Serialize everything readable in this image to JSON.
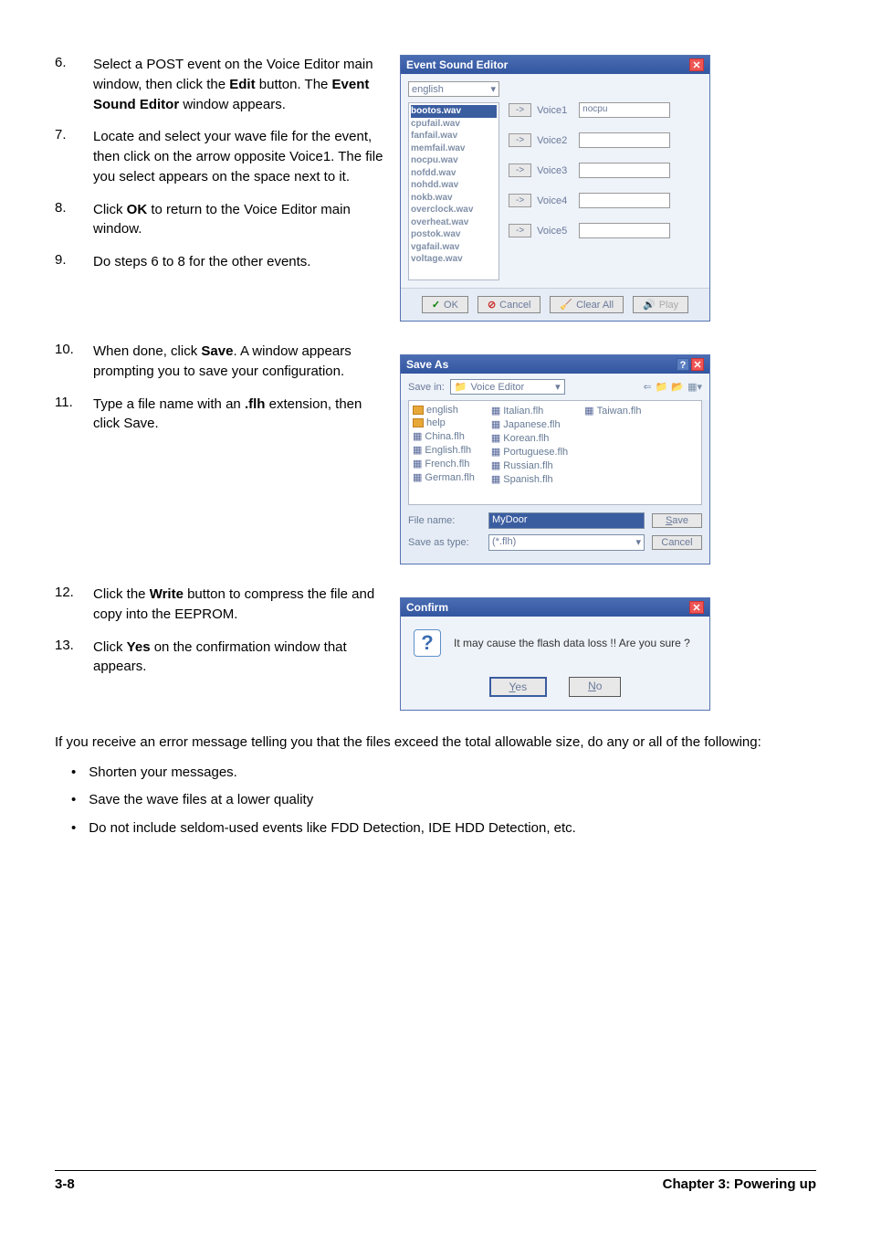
{
  "steps": {
    "s6": {
      "num": "6.",
      "text_a": "Select a POST event on the Voice Editor main window, then click the ",
      "bold1": "Edit",
      "text_b": " button. The ",
      "bold2": "Event Sound Editor",
      "text_c": " window appears."
    },
    "s7": {
      "num": "7.",
      "text": "Locate and select your wave file for the event, then click on the arrow opposite Voice1. The file you select appears on the space next to it."
    },
    "s8": {
      "num": "8.",
      "text_a": "Click ",
      "bold1": "OK",
      "text_b": " to return to the Voice Editor main window."
    },
    "s9": {
      "num": "9.",
      "text": "Do steps 6 to 8 for the other events."
    },
    "s10": {
      "num": "10.",
      "text_a": "When done, click ",
      "bold1": "Save",
      "text_b": ". A window appears prompting you to save your configuration."
    },
    "s11": {
      "num": "11.",
      "text_a": "Type a file name with an ",
      "bold1": ".flh",
      "text_b": " extension, then click Save."
    },
    "s12": {
      "num": "12.",
      "text_a": "Click the ",
      "bold1": "Write",
      "text_b": " button to compress the file and copy into the EEPROM."
    },
    "s13": {
      "num": "13.",
      "text_a": "Click ",
      "bold1": "Yes",
      "text_b": " on the confirmation window that appears."
    }
  },
  "paragraph": "If you receive an error message telling you that the files exceed the total allowable size, do any or all of the following:",
  "bullets": [
    "Shorten your messages.",
    "Save the wave files at a lower quality",
    "Do not include seldom-used events like FDD Detection, IDE HDD Detection, etc."
  ],
  "ese": {
    "title": "Event Sound Editor",
    "dropdown": "english",
    "files": [
      "bootos.wav",
      "cpufail.wav",
      "fanfail.wav",
      "memfail.wav",
      "nocpu.wav",
      "nofdd.wav",
      "nohdd.wav",
      "nokb.wav",
      "overclock.wav",
      "overheat.wav",
      "postok.wav",
      "vgafail.wav",
      "voltage.wav"
    ],
    "voices": [
      {
        "label": "Voice1",
        "value": "nocpu"
      },
      {
        "label": "Voice2",
        "value": ""
      },
      {
        "label": "Voice3",
        "value": ""
      },
      {
        "label": "Voice4",
        "value": ""
      },
      {
        "label": "Voice5",
        "value": ""
      }
    ],
    "buttons": {
      "ok": "OK",
      "cancel": "Cancel",
      "clearall": "Clear All",
      "play": "Play"
    }
  },
  "saveas": {
    "title": "Save As",
    "save_in_label": "Save in:",
    "folder": "Voice Editor",
    "col1": [
      "english",
      "help",
      "China.flh",
      "English.flh",
      "French.flh",
      "German.flh"
    ],
    "col2": [
      "Italian.flh",
      "Japanese.flh",
      "Korean.flh",
      "Portuguese.flh",
      "Russian.flh",
      "Spanish.flh"
    ],
    "col3": [
      "Taiwan.flh"
    ],
    "file_name_label": "File name:",
    "file_name_value": "MyDoor",
    "save_as_type_label": "Save as type:",
    "save_as_type_value": "(*.flh)",
    "save_btn": "Save",
    "cancel_btn": "Cancel"
  },
  "confirm": {
    "title": "Confirm",
    "message": "It may cause the flash data loss !!  Are you sure ?",
    "yes": "Yes",
    "no": "No"
  },
  "footer": {
    "left": "3-8",
    "right": "Chapter 3: Powering up"
  }
}
